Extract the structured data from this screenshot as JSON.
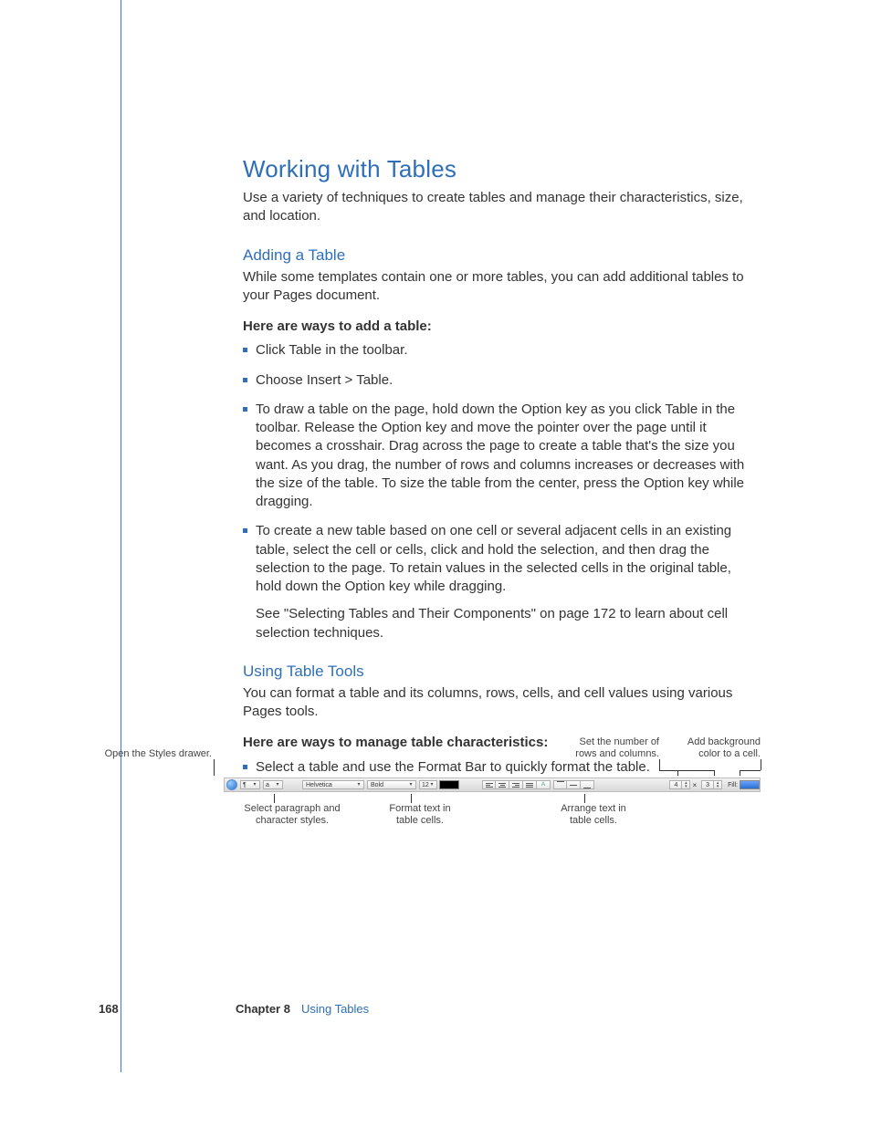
{
  "footer": {
    "page_number": "168",
    "chapter_label": "Chapter 8",
    "chapter_title": "Using Tables"
  },
  "main_heading": "Working with Tables",
  "main_intro": "Use a variety of techniques to create tables and manage their characteristics, size, and location.",
  "section_adding": {
    "heading": "Adding a Table",
    "intro": "While some templates contain one or more tables, you can add additional tables to your Pages document.",
    "subhead": "Here are ways to add a table:",
    "bullets": [
      "Click Table in the toolbar.",
      "Choose Insert > Table.",
      "To draw a table on the page, hold down the Option key as you click Table in the toolbar. Release the Option key and move the pointer over the page until it becomes a crosshair. Drag across the page to create a table that's the size you want. As you drag, the number of rows and columns increases or decreases with the size of the table. To size the table from the center, press the Option key while dragging.",
      "To create a new table based on one cell or several adjacent cells in an existing table, select the cell or cells, click and hold the selection, and then drag the selection to the page. To retain values in the selected cells in the original table, hold down the Option key while dragging."
    ],
    "trailing": "See \"Selecting Tables and Their Components\" on page 172 to learn about cell selection techniques."
  },
  "section_tools": {
    "heading": "Using Table Tools",
    "intro": "You can format a table and its columns, rows, cells, and cell values using various Pages tools.",
    "subhead": "Here are ways to manage table characteristics:",
    "bullets": [
      "Select a table and use the Format Bar to quickly format the table."
    ]
  },
  "annotations": {
    "open_styles": "Open the Styles drawer.",
    "set_rows_cols": "Set the number of\nrows and columns.",
    "add_bg": "Add background\ncolor to a cell.",
    "sel_styles": "Select paragraph and\ncharacter styles.",
    "format_text": "Format text in\ntable cells.",
    "arrange_text": "Arrange text in\ntable cells."
  },
  "format_bar": {
    "font": "Helvetica",
    "weight": "Bold",
    "size": "12",
    "rows": "4",
    "cols": "3",
    "fill_label": "Fill:"
  }
}
